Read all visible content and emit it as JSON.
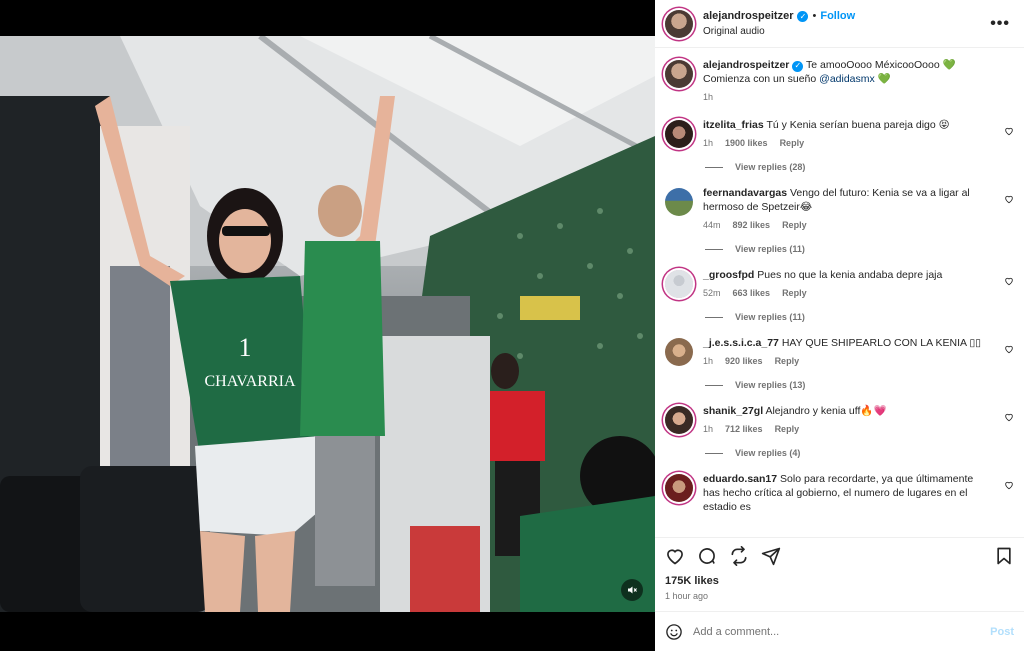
{
  "header": {
    "username": "alejandrospeitzer",
    "follow_label": "Follow",
    "dot": "•",
    "audio": "Original audio",
    "more": "•••"
  },
  "caption": {
    "username": "alejandrospeitzer",
    "line1": "Te amooOooo MéxicooOooo 💚",
    "line2_prefix": "Comienza con un sueño ",
    "mention": "@adidasmx",
    "line2_suffix": " 💚",
    "time": "1h"
  },
  "comments": [
    {
      "username": "itzelita_frias",
      "text": "Tú y Kenia serían buena pareja digo 😝",
      "time": "1h",
      "likes": "1900 likes",
      "reply": "Reply",
      "view_replies": "View replies (28)"
    },
    {
      "username": "feernandavargas",
      "text": "Vengo del futuro: Kenia se va a ligar al hermoso de Spetzeir😂",
      "time": "44m",
      "likes": "892 likes",
      "reply": "Reply",
      "view_replies": "View replies (11)"
    },
    {
      "username": "_groosfpd",
      "text": "Pues no que la kenia andaba depre jaja",
      "time": "52m",
      "likes": "663 likes",
      "reply": "Reply",
      "view_replies": "View replies (11)"
    },
    {
      "username": "_j.e.s.s.i.c.a_77",
      "text": "HAY QUE SHIPEARLO CON LA KENIA ▯▯",
      "time": "1h",
      "likes": "920 likes",
      "reply": "Reply",
      "view_replies": "View replies (13)"
    },
    {
      "username": "shanik_27gl",
      "text": "Alejandro y kenia uff🔥💗",
      "time": "1h",
      "likes": "712 likes",
      "reply": "Reply",
      "view_replies": "View replies (4)"
    },
    {
      "username": "eduardo.san17",
      "text": "Solo para recordarte, ya que últimamente has hecho crítica al gobierno, el numero de lugares en el estadio es"
    }
  ],
  "stats": {
    "likes": "175K likes",
    "time_ago": "1 hour ago"
  },
  "add_comment": {
    "placeholder": "Add a comment...",
    "post_label": "Post"
  },
  "colors": {
    "accent": "#0095f6",
    "mention": "#00376b",
    "muted": "#737373",
    "heart_red": "#ed4956",
    "post_disabled": "#b2dffc"
  },
  "icons": [
    "verified-badge-icon",
    "more-options-icon",
    "heart-icon",
    "comment-icon",
    "share-icon",
    "bookmark-icon",
    "emoji-icon",
    "mute-icon"
  ]
}
